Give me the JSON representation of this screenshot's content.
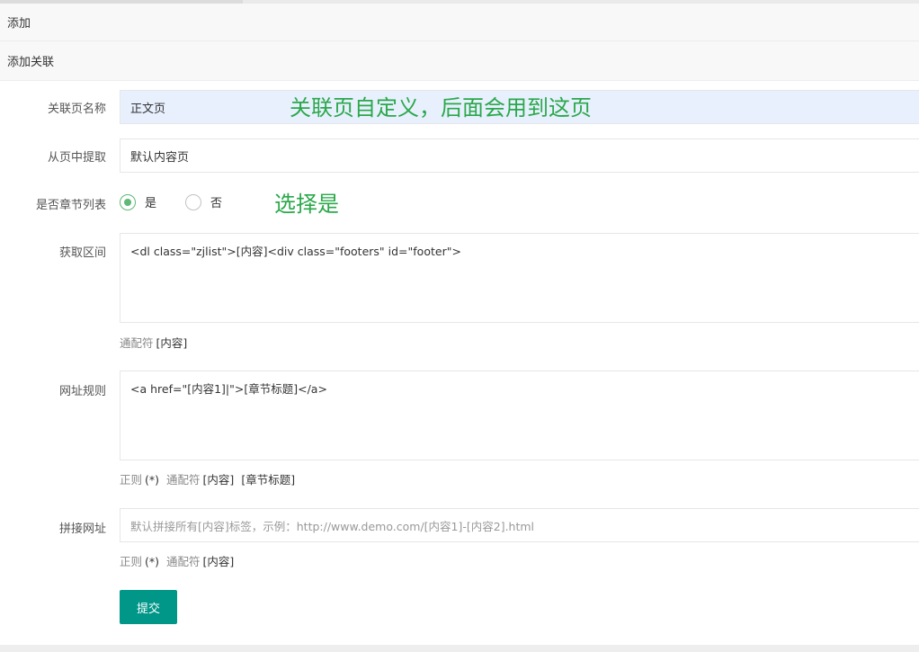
{
  "sections": {
    "add": "添加",
    "add_relation": "添加关联"
  },
  "form": {
    "page_name": {
      "label": "关联页名称",
      "value": "正文页"
    },
    "extract_from": {
      "label": "从页中提取",
      "value": "默认内容页"
    },
    "is_chapter_list": {
      "label": "是否章节列表",
      "options": [
        {
          "label": "是",
          "selected": true
        },
        {
          "label": "否",
          "selected": false
        }
      ]
    },
    "range": {
      "label": "获取区间",
      "value": "<dl class=\"zjlist\">[内容]<div class=\"footers\" id=\"footer\">",
      "hint_prefix": "通配符",
      "hint_tag": "[内容]"
    },
    "url_rule": {
      "label": "网址规则",
      "value": "<a href=\"[内容1]|\">[章节标题]</a>",
      "hint_regex": "正则",
      "hint_regex_tag": "(*)",
      "hint_prefix": "通配符",
      "hint_tag": "[内容]",
      "hint_tag2": "[章节标题]"
    },
    "join_url": {
      "label": "拼接网址",
      "placeholder": "默认拼接所有[内容]标签，示例：http://www.demo.com/[内容1]-[内容2].html",
      "hint_regex": "正则",
      "hint_regex_tag": "(*)",
      "hint_prefix": "通配符",
      "hint_tag": "[内容]"
    },
    "submit_label": "提交"
  },
  "annotations": {
    "page_name_note": "关联页自定义，后面会用到这页",
    "chapter_note": "选择是"
  },
  "colors": {
    "accent": "#009688",
    "radio": "#5fb878",
    "annotation": "#2aa84a"
  }
}
